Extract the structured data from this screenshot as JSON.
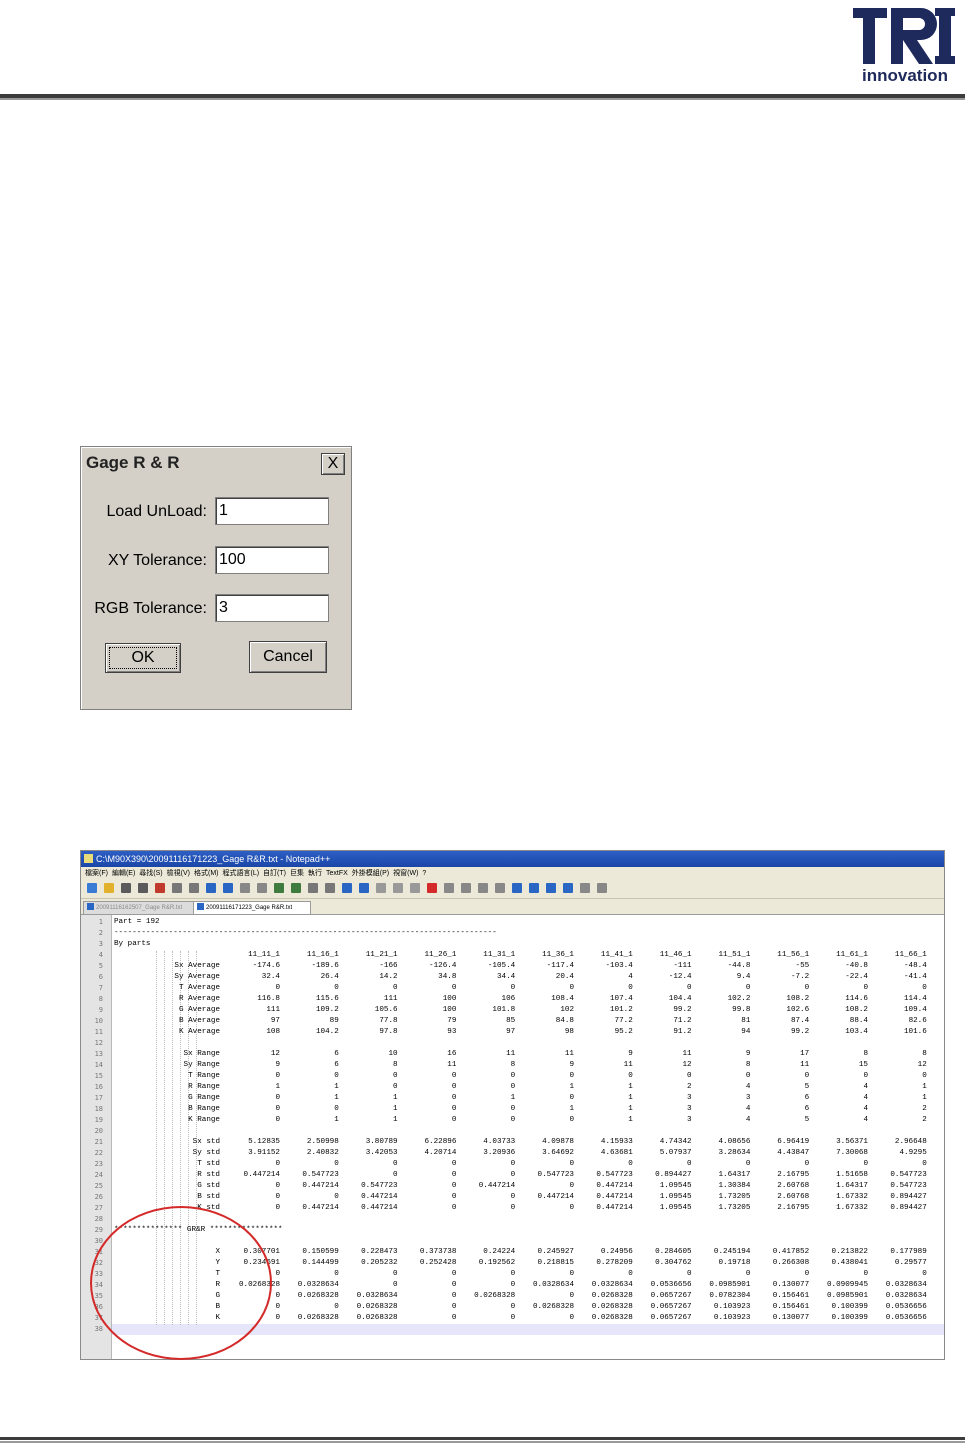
{
  "logo": {
    "mark": "TRI",
    "wordmark": "innovation",
    "brand_color": "#1f2a5c"
  },
  "dialog": {
    "title": "Gage R & R",
    "close_label": "X",
    "fields": [
      {
        "label": "Load UnLoad:",
        "value": "1"
      },
      {
        "label": "XY Tolerance:",
        "value": "100"
      },
      {
        "label": "RGB Tolerance:",
        "value": "3"
      }
    ],
    "ok_label": "OK",
    "cancel_label": "Cancel"
  },
  "notepad": {
    "window_title": "C:\\M90X390\\20091116171223_Gage R&R.txt - Notepad++",
    "menu": [
      "檔案(F)",
      "編輯(E)",
      "尋找(S)",
      "檢視(V)",
      "格式(M)",
      "程式語言(L)",
      "自訂(T)",
      "巨集",
      "執行",
      "TextFX",
      "外掛模組(P)",
      "視窗(W)",
      "?"
    ],
    "tabs": [
      "20091116162507_Gage R&R.txt",
      "20091116171223_Gage R&R.txt"
    ],
    "line1": "Part = 192",
    "line2": "------------------------------------------------------------------------------------",
    "line3": "By parts",
    "gr_header": "*************** GR&R ****************",
    "columns": [
      "11_11_1",
      "11_16_1",
      "11_21_1",
      "11_26_1",
      "11_31_1",
      "11_36_1",
      "11_41_1",
      "11_46_1",
      "11_51_1",
      "11_56_1",
      "11_61_1",
      "11_66_1"
    ],
    "rows": [
      {
        "line": 5,
        "label": "Sx Average",
        "values": [
          "-174.6",
          "-189.6",
          "-166",
          "-126.4",
          "-105.4",
          "-117.4",
          "-103.4",
          "-111",
          "-44.8",
          "-55",
          "-40.8",
          "-48.4"
        ]
      },
      {
        "line": 6,
        "label": "Sy Average",
        "values": [
          "32.4",
          "26.4",
          "14.2",
          "34.8",
          "34.4",
          "20.4",
          "4",
          "-12.4",
          "9.4",
          "-7.2",
          "-22.4",
          "-41.4"
        ]
      },
      {
        "line": 7,
        "label": "T Average",
        "values": [
          "0",
          "0",
          "0",
          "0",
          "0",
          "0",
          "0",
          "0",
          "0",
          "0",
          "0",
          "0"
        ]
      },
      {
        "line": 8,
        "label": "R Average",
        "values": [
          "116.8",
          "115.6",
          "111",
          "100",
          "106",
          "108.4",
          "107.4",
          "104.4",
          "102.2",
          "108.2",
          "114.6",
          "114.4"
        ]
      },
      {
        "line": 9,
        "label": "G Average",
        "values": [
          "111",
          "109.2",
          "105.6",
          "100",
          "101.8",
          "102",
          "101.2",
          "99.2",
          "99.8",
          "102.6",
          "108.2",
          "109.4"
        ]
      },
      {
        "line": 10,
        "label": "B Average",
        "values": [
          "97",
          "89",
          "77.8",
          "79",
          "85",
          "84.8",
          "77.2",
          "71.2",
          "81",
          "87.4",
          "88.4",
          "82.6"
        ]
      },
      {
        "line": 11,
        "label": "K Average",
        "values": [
          "108",
          "104.2",
          "97.8",
          "93",
          "97",
          "98",
          "95.2",
          "91.2",
          "94",
          "99.2",
          "103.4",
          "101.6"
        ]
      },
      {
        "line": 13,
        "label": "Sx Range",
        "values": [
          "12",
          "6",
          "10",
          "16",
          "11",
          "11",
          "9",
          "11",
          "9",
          "17",
          "8",
          "8"
        ]
      },
      {
        "line": 14,
        "label": "Sy Range",
        "values": [
          "9",
          "6",
          "8",
          "11",
          "8",
          "9",
          "11",
          "12",
          "8",
          "11",
          "15",
          "12"
        ]
      },
      {
        "line": 15,
        "label": "T Range",
        "values": [
          "0",
          "0",
          "0",
          "0",
          "0",
          "0",
          "0",
          "0",
          "0",
          "0",
          "0",
          "0"
        ]
      },
      {
        "line": 16,
        "label": "R Range",
        "values": [
          "1",
          "1",
          "0",
          "0",
          "0",
          "1",
          "1",
          "2",
          "4",
          "5",
          "4",
          "1"
        ]
      },
      {
        "line": 17,
        "label": "G Range",
        "values": [
          "0",
          "1",
          "1",
          "0",
          "1",
          "0",
          "1",
          "3",
          "3",
          "6",
          "4",
          "1"
        ]
      },
      {
        "line": 18,
        "label": "B Range",
        "values": [
          "0",
          "0",
          "1",
          "0",
          "0",
          "1",
          "1",
          "3",
          "4",
          "6",
          "4",
          "2"
        ]
      },
      {
        "line": 19,
        "label": "K Range",
        "values": [
          "0",
          "1",
          "1",
          "0",
          "0",
          "0",
          "1",
          "3",
          "4",
          "5",
          "4",
          "2"
        ]
      },
      {
        "line": 21,
        "label": "Sx std",
        "values": [
          "5.12835",
          "2.50998",
          "3.80789",
          "6.22896",
          "4.03733",
          "4.09878",
          "4.15933",
          "4.74342",
          "4.08656",
          "6.96419",
          "3.56371",
          "2.96648"
        ]
      },
      {
        "line": 22,
        "label": "Sy std",
        "values": [
          "3.91152",
          "2.40832",
          "3.42053",
          "4.20714",
          "3.20936",
          "3.64692",
          "4.63681",
          "5.07937",
          "3.28634",
          "4.43847",
          "7.30068",
          "4.9295"
        ]
      },
      {
        "line": 23,
        "label": "T std",
        "values": [
          "0",
          "0",
          "0",
          "0",
          "0",
          "0",
          "0",
          "0",
          "0",
          "0",
          "0",
          "0"
        ]
      },
      {
        "line": 24,
        "label": "R std",
        "values": [
          "0.447214",
          "0.547723",
          "0",
          "0",
          "0",
          "0.547723",
          "0.547723",
          "0.894427",
          "1.64317",
          "2.16795",
          "1.51658",
          "0.547723"
        ]
      },
      {
        "line": 25,
        "label": "G std",
        "values": [
          "0",
          "0.447214",
          "0.547723",
          "0",
          "0.447214",
          "0",
          "0.447214",
          "1.09545",
          "1.30384",
          "2.60768",
          "1.64317",
          "0.547723"
        ]
      },
      {
        "line": 26,
        "label": "B std",
        "values": [
          "0",
          "0",
          "0.447214",
          "0",
          "0",
          "0.447214",
          "0.447214",
          "1.09545",
          "1.73205",
          "2.60768",
          "1.67332",
          "0.894427"
        ]
      },
      {
        "line": 27,
        "label": "K std",
        "values": [
          "0",
          "0.447214",
          "0.447214",
          "0",
          "0",
          "0",
          "0.447214",
          "1.09545",
          "1.73205",
          "2.16795",
          "1.67332",
          "0.894427"
        ]
      },
      {
        "line": 31,
        "label": "X",
        "values": [
          "0.307701",
          "0.150599",
          "0.228473",
          "0.373738",
          "0.24224",
          "0.245927",
          "0.24956",
          "0.284605",
          "0.245194",
          "0.417852",
          "0.213822",
          "0.177989"
        ]
      },
      {
        "line": 32,
        "label": "Y",
        "values": [
          "0.234691",
          "0.144499",
          "0.205232",
          "0.252428",
          "0.192562",
          "0.218815",
          "0.278209",
          "0.304762",
          "0.19718",
          "0.266308",
          "0.438041",
          "0.29577"
        ]
      },
      {
        "line": 33,
        "label": "T",
        "values": [
          "0",
          "0",
          "0",
          "0",
          "0",
          "0",
          "0",
          "0",
          "0",
          "0",
          "0",
          "0"
        ]
      },
      {
        "line": 34,
        "label": "R",
        "values": [
          "0.0268328",
          "0.0328634",
          "0",
          "0",
          "0",
          "0.0328634",
          "0.0328634",
          "0.0536656",
          "0.0985901",
          "0.130077",
          "0.0909945",
          "0.0328634"
        ]
      },
      {
        "line": 35,
        "label": "G",
        "values": [
          "0",
          "0.0268328",
          "0.0328634",
          "0",
          "0.0268328",
          "0",
          "0.0268328",
          "0.0657267",
          "0.0782304",
          "0.156461",
          "0.0985901",
          "0.0328634"
        ]
      },
      {
        "line": 36,
        "label": "B",
        "values": [
          "0",
          "0",
          "0.0268328",
          "0",
          "0",
          "0.0268328",
          "0.0268328",
          "0.0657267",
          "0.103923",
          "0.156461",
          "0.100399",
          "0.0536656"
        ]
      },
      {
        "line": 37,
        "label": "K",
        "values": [
          "0",
          "0.0268328",
          "0.0268328",
          "0",
          "0",
          "0",
          "0.0268328",
          "0.0657267",
          "0.103923",
          "0.130077",
          "0.100399",
          "0.0536656"
        ]
      }
    ],
    "line_numbers": [
      "1",
      "2",
      "3",
      "4",
      "5",
      "6",
      "7",
      "8",
      "9",
      "10",
      "11",
      "12",
      "13",
      "14",
      "15",
      "16",
      "17",
      "18",
      "19",
      "20",
      "21",
      "22",
      "23",
      "24",
      "25",
      "26",
      "27",
      "28",
      "29",
      "30",
      "31",
      "32",
      "33",
      "34",
      "35",
      "36",
      "37",
      "38"
    ]
  },
  "annotation": {
    "circle_color": "#d42a2a"
  }
}
